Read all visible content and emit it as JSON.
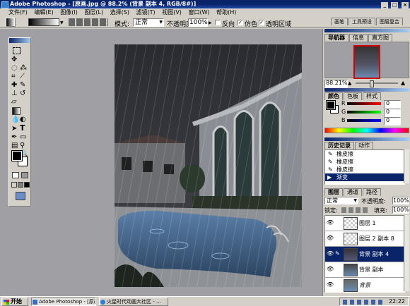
{
  "window": {
    "title": "Adobe Photoshop - [原画.jpg @ 88.2% (背景 副本 4, RGB/8#)]",
    "title_controls": [
      "_",
      "□",
      "×"
    ]
  },
  "menu": [
    "文件(F)",
    "编辑(E)",
    "图像(I)",
    "图层(L)",
    "选择(S)",
    "滤镜(T)",
    "视图(V)",
    "窗口(W)",
    "帮助(H)"
  ],
  "options_bar": {
    "mode_label": "模式:",
    "mode_value": "正常",
    "opacity_label": "不透明度:",
    "opacity_value": "100%",
    "reverse_label": "反向",
    "dither_label": "仿色",
    "transparency_label": "透明区域"
  },
  "palette_well": [
    "画笔",
    "工具预设",
    "图层复合"
  ],
  "navigator": {
    "tabs": [
      "导航器",
      "信息",
      "直方图"
    ],
    "zoom": "88.21%"
  },
  "color_panel": {
    "tabs": [
      "颜色",
      "色板",
      "样式"
    ],
    "channels": [
      {
        "label": "R",
        "value": "0",
        "color": "#ff0000"
      },
      {
        "label": "G",
        "value": "0",
        "color": "#00ff00"
      },
      {
        "label": "B",
        "value": "0",
        "color": "#0000ff"
      }
    ]
  },
  "history_panel": {
    "tabs": [
      "历史记录",
      "动作"
    ],
    "items": [
      "橡皮擦",
      "橡皮擦",
      "橡皮擦",
      "渐变"
    ],
    "selected_index": 3
  },
  "layers_panel": {
    "tabs": [
      "图层",
      "通道",
      "路径"
    ],
    "blend_mode": "正常",
    "opacity_label": "不透明度:",
    "opacity_value": "100%",
    "lock_label": "锁定:",
    "fill_label": "填充:",
    "fill_value": "100%",
    "layers": [
      {
        "name": "图层 1",
        "selected": false
      },
      {
        "name": "图层 2 副本 8",
        "selected": false
      },
      {
        "name": "背景 副本 4",
        "selected": true
      },
      {
        "name": "背景 副本",
        "selected": false
      },
      {
        "name": "背景",
        "selected": false
      }
    ]
  },
  "taskbar": {
    "start_label": "开始",
    "tasks": [
      "Adobe Photoshop - [原画...",
      "火星时代动画大社区 - ..."
    ],
    "clock": "22:22"
  }
}
